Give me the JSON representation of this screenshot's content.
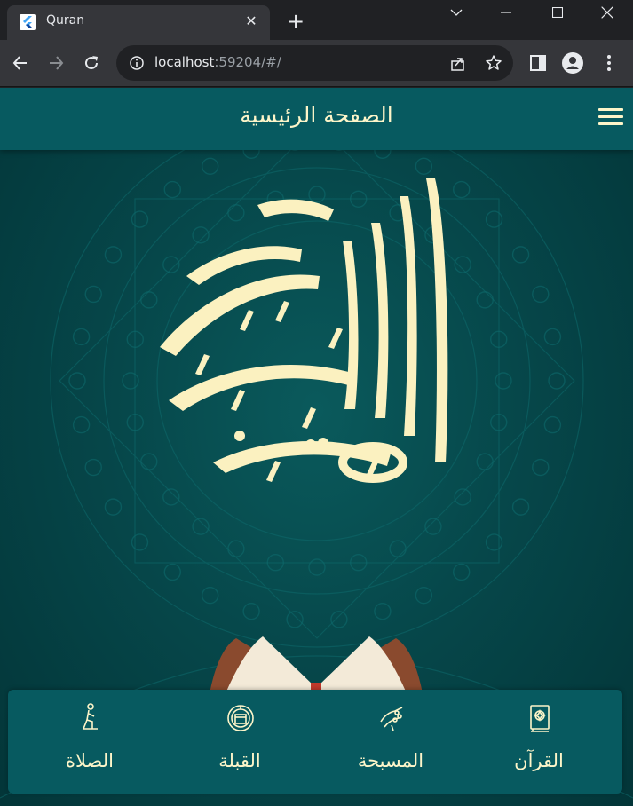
{
  "browser": {
    "tab_title": "Quran",
    "tab_close": "✕",
    "new_tab": "+",
    "url_host": "localhost",
    "url_rest": ":59204/#/",
    "icons": [
      "flutter-favicon",
      "close-icon",
      "plus-icon",
      "chevron-down-icon",
      "minimize-icon",
      "maximize-icon",
      "close-window-icon",
      "back-arrow-icon",
      "forward-arrow-icon",
      "reload-icon",
      "info-icon",
      "share-icon",
      "star-icon",
      "side-panel-icon",
      "profile-icon",
      "more-vert-icon"
    ]
  },
  "app": {
    "title": "الصفحة الرئيسية",
    "menu_icon": "hamburger-menu-icon",
    "bottom_nav": [
      {
        "label": "القرآن",
        "icon": "quran-book-icon"
      },
      {
        "label": "المسبحة",
        "icon": "tasbih-hand-icon"
      },
      {
        "label": "القبلة",
        "icon": "kaaba-compass-icon"
      },
      {
        "label": "الصلاة",
        "icon": "praying-person-icon"
      }
    ],
    "colors": {
      "appbar": "#075a60",
      "background": "#06474a",
      "accent_text": "#fdf5c9"
    }
  }
}
